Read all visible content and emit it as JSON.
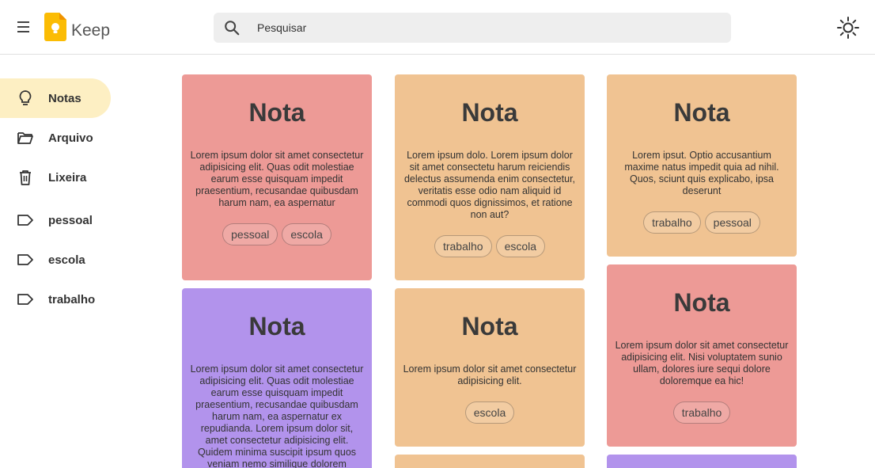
{
  "header": {
    "app_title": "Keep",
    "search_placeholder": "Pesquisar"
  },
  "colors": {
    "red": "#ed9a96",
    "orange": "#f0c392",
    "purple": "#b293ec",
    "active_bg": "#fdefc3",
    "logo": "#fbbc04"
  },
  "sidebar": {
    "items": [
      {
        "label": "Notas",
        "icon": "lightbulb-icon",
        "active": true
      },
      {
        "label": "Arquivo",
        "icon": "folder-icon",
        "active": false
      },
      {
        "label": "Lixeira",
        "icon": "trash-icon",
        "active": false
      },
      {
        "label": "pessoal",
        "icon": "label-icon",
        "active": false
      },
      {
        "label": "escola",
        "icon": "label-icon",
        "active": false
      },
      {
        "label": "trabalho",
        "icon": "label-icon",
        "active": false
      }
    ]
  },
  "notes": [
    {
      "title": "Nota",
      "color": "red",
      "body": "Lorem ipsum dolor sit amet consectetur adipisicing elit. Quas odit molestiae earum esse quisquam impedit praesentium, recusandae quibusdam harum nam, ea aspernatur",
      "tags": [
        "pessoal",
        "escola"
      ]
    },
    {
      "title": "Nota",
      "color": "orange",
      "body": "Lorem ipsum dolo. Lorem ipsum dolor sit amet consectetu harum reiciendis delectus assumenda enim consectetur, veritatis esse odio nam aliquid id commodi quos dignissimos, et ratione non aut?",
      "tags": [
        "trabalho",
        "escola"
      ]
    },
    {
      "title": "Nota",
      "color": "orange",
      "body": "Lorem ipsut. Optio accusantium maxime natus impedit quia ad nihil. Quos, sciunt quis explicabo, ipsa deserunt",
      "tags": [
        "trabalho",
        "pessoal"
      ]
    },
    {
      "title": "Nota",
      "color": "purple",
      "body": "Lorem ipsum dolor sit amet consectetur adipisicing elit. Quas odit molestiae earum esse quisquam impedit praesentium, recusandae quibusdam harum nam, ea aspernatur ex repudianda. Lorem ipsum dolor sit, amet consectetur adipisicing elit. Quidem minima suscipit ipsum quos veniam nemo similique dolorem",
      "tags": []
    },
    {
      "title": "Nota",
      "color": "orange",
      "body": "Lorem ipsum dolor sit amet consectetur adipisicing elit.",
      "tags": [
        "escola"
      ]
    },
    {
      "title": "Nota",
      "color": "red",
      "body": "Lorem ipsum dolor sit amet consectetur adipisicing elit. Nisi voluptatem sunio ullam, dolores iure sequi dolore doloremque ea hic!",
      "tags": [
        "trabalho"
      ]
    }
  ]
}
